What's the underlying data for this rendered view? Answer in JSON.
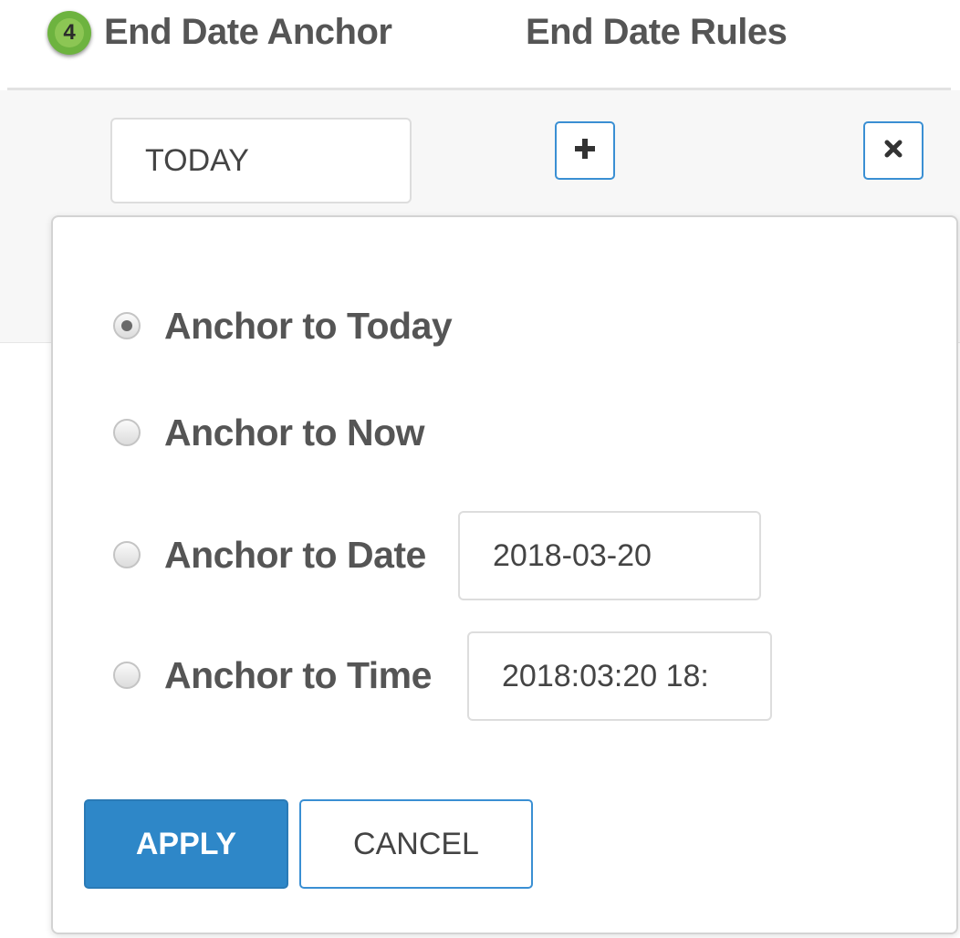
{
  "header": {
    "step_number": "4",
    "anchor_column_title": "End Date Anchor",
    "rules_column_title": "End Date Rules"
  },
  "row": {
    "anchor_value": "TODAY",
    "add_icon": "plus-icon",
    "remove_icon": "close-icon"
  },
  "popover": {
    "options": [
      {
        "label": "Anchor to Today",
        "selected": true
      },
      {
        "label": "Anchor to Now",
        "selected": false
      },
      {
        "label": "Anchor to Date",
        "selected": false
      },
      {
        "label": "Anchor to Time",
        "selected": false
      }
    ],
    "date_value": "2018-03-20",
    "time_value": "2018:03:20 18:",
    "apply_label": "APPLY",
    "cancel_label": "CANCEL"
  },
  "colors": {
    "step_badge": "#6db33f",
    "accent": "#2e87c8",
    "text": "#555555"
  }
}
